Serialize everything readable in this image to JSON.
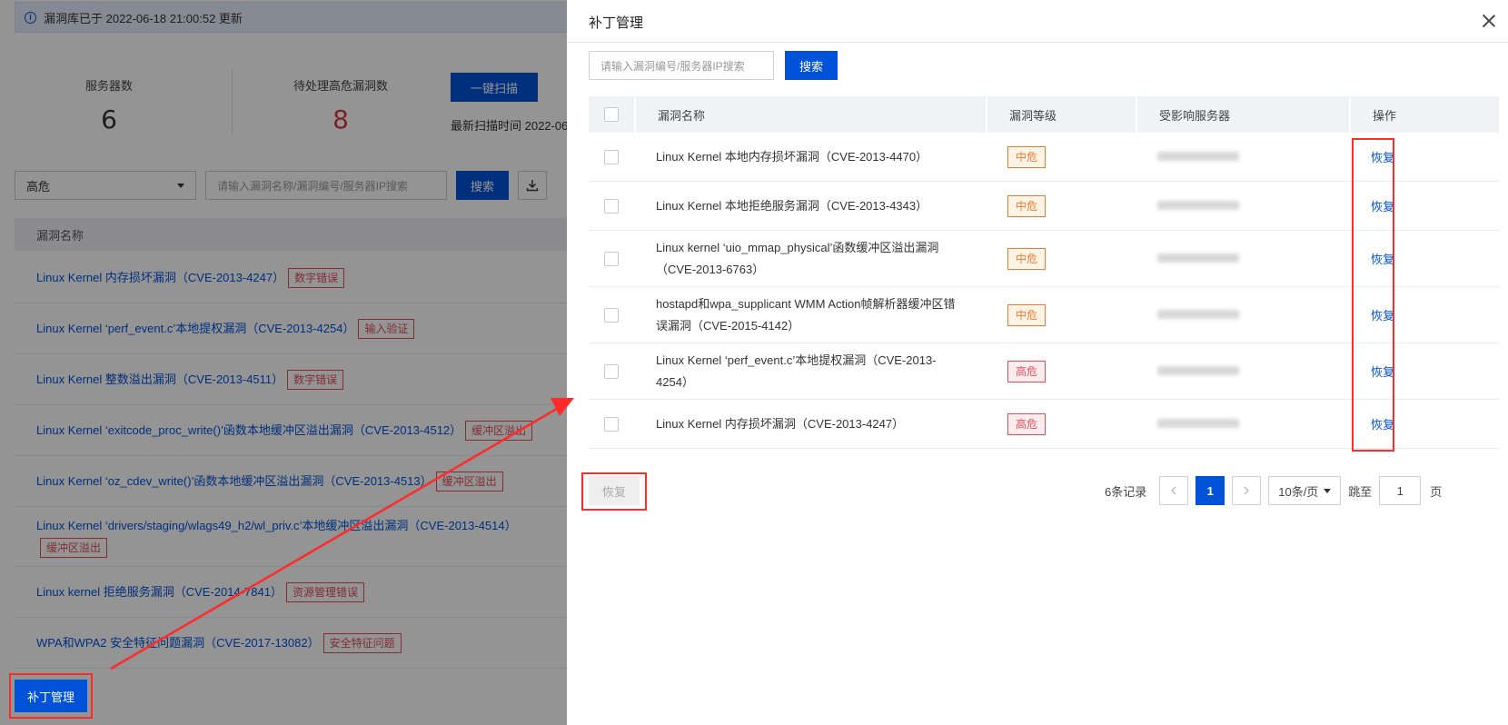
{
  "background": {
    "notice": "漏洞库已于 2022-06-18 21:00:52 更新",
    "stats": [
      {
        "label": "服务器数",
        "value": "6",
        "color": "#333333"
      },
      {
        "label": "待处理高危漏洞数",
        "value": "8",
        "color": "#d9363e"
      }
    ],
    "scan_button": "一键扫描",
    "scan_time": "最新扫描时间 2022-06-",
    "level_select": "高危",
    "search_placeholder": "请输入漏洞名称/漏洞编号/服务器IP搜索",
    "search_button": "搜索",
    "table_header": "漏洞名称",
    "rows": [
      {
        "name": "Linux Kernel 内存损坏漏洞（CVE-2013-4247）",
        "tag": "数字错误"
      },
      {
        "name": "Linux Kernel ‘perf_event.c’本地提权漏洞（CVE-2013-4254）",
        "tag": "输入验证"
      },
      {
        "name": "Linux Kernel 整数溢出漏洞（CVE-2013-4511）",
        "tag": "数字错误"
      },
      {
        "name": "Linux Kernel ‘exitcode_proc_write()’函数本地缓冲区溢出漏洞（CVE-2013-4512）",
        "tag": "缓冲区溢出"
      },
      {
        "name": "Linux Kernel ‘oz_cdev_write()’函数本地缓冲区溢出漏洞（CVE-2013-4513）",
        "tag": "缓冲区溢出"
      },
      {
        "name": "Linux Kernel ‘drivers/staging/wlags49_h2/wl_priv.c’本地缓冲区溢出漏洞（CVE-2013-4514）",
        "tag": "缓冲区溢出"
      },
      {
        "name": "Linux kernel 拒绝服务漏洞（CVE-2014-7841）",
        "tag": "资源管理错误"
      },
      {
        "name": "WPA和WPA2 安全特征问题漏洞（CVE-2017-13082）",
        "tag": "安全特征问题"
      }
    ],
    "patch_button": "补丁管理"
  },
  "drawer": {
    "title": "补丁管理",
    "search_placeholder": "请输入漏洞编号/服务器IP搜索",
    "search_button": "搜索",
    "columns": {
      "name": "漏洞名称",
      "level": "漏洞等级",
      "server": "受影响服务器",
      "op": "操作"
    },
    "rows": [
      {
        "name": "Linux Kernel 本地内存损坏漏洞（CVE-2013-4470）",
        "level": "中危",
        "severity": "mid",
        "op": "恢复"
      },
      {
        "name": "Linux Kernel 本地拒绝服务漏洞（CVE-2013-4343）",
        "level": "中危",
        "severity": "mid",
        "op": "恢复"
      },
      {
        "name": "Linux kernel ‘uio_mmap_physical’函数缓冲区溢出漏洞（CVE-2013-6763）",
        "level": "中危",
        "severity": "mid",
        "op": "恢复"
      },
      {
        "name": "hostapd和wpa_supplicant WMM Action帧解析器缓冲区错误漏洞（CVE-2015-4142）",
        "level": "中危",
        "severity": "mid",
        "op": "恢复"
      },
      {
        "name": "Linux Kernel ‘perf_event.c’本地提权漏洞（CVE-2013-4254）",
        "level": "高危",
        "severity": "high",
        "op": "恢复"
      },
      {
        "name": "Linux Kernel 内存损坏漏洞（CVE-2013-4247）",
        "level": "高危",
        "severity": "high",
        "op": "恢复"
      }
    ],
    "restore_button": "恢复",
    "pagination": {
      "total": "6条记录",
      "current_page": "1",
      "page_size": "10条/页",
      "jump_label": "跳至",
      "jump_value": "1",
      "page_suffix": "页"
    }
  },
  "colors": {
    "primary": "#0052d9",
    "highlight": "#ff2a2a",
    "medium": "#ed7b2f",
    "high": "#e34d59"
  }
}
